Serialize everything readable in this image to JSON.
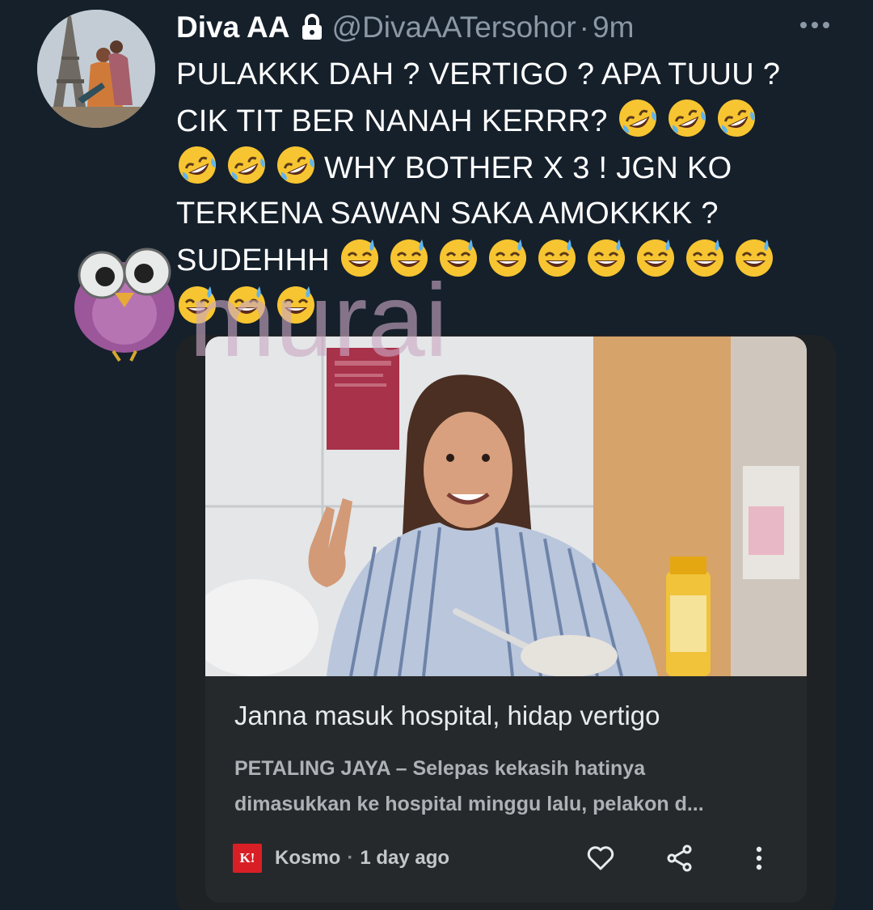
{
  "tweet": {
    "display_name": "Diva AA",
    "handle": "@DivaAATersohor",
    "separator": "·",
    "time": "9m",
    "text_lines": [
      "PULAKKK DAH ? VERTIGO ? APA TUUU ?",
      "CIK TIT BER NANAH KERRR?",
      "WHY BOTHER X 3 ! JGN KO",
      "TERKENA SAWAN SAKA AMOKKKK ?",
      "SUDEHHH"
    ],
    "emoji": {
      "line2": [
        "rofl",
        "rofl",
        "rofl"
      ],
      "line3": [
        "rofl",
        "rofl",
        "rofl"
      ],
      "line5": [
        "sweat-smile",
        "sweat-smile",
        "sweat-smile",
        "sweat-smile",
        "sweat-smile",
        "sweat-smile",
        "sweat-smile",
        "sweat-smile",
        "sweat-smile"
      ],
      "line6": [
        "sweat-smile",
        "sweat-smile",
        "sweat-smile"
      ]
    }
  },
  "watermark": {
    "text": "murai",
    "mascot_icon": "owl-icon",
    "color": "#c9a8c4"
  },
  "card": {
    "headline": "Janna masuk hospital, hidap vertigo",
    "snippet_lines": [
      "PETALING JAYA – Selepas kekasih hatinya",
      "dimasukkan ke hospital minggu lalu, pelakon d..."
    ],
    "source_logo_text": "K!",
    "source_name": "Kosmo",
    "separator": "·",
    "age": "1 day ago",
    "actions": [
      "heart-icon",
      "share-icon",
      "more-vertical-icon"
    ]
  },
  "colors": {
    "background": "#15202b",
    "secondary_text": "#8b98a5",
    "card_background": "#26292b",
    "source_brand": "#d91f26"
  },
  "icons": {
    "lock": "lock-icon",
    "more": "more-horizontal-icon"
  }
}
